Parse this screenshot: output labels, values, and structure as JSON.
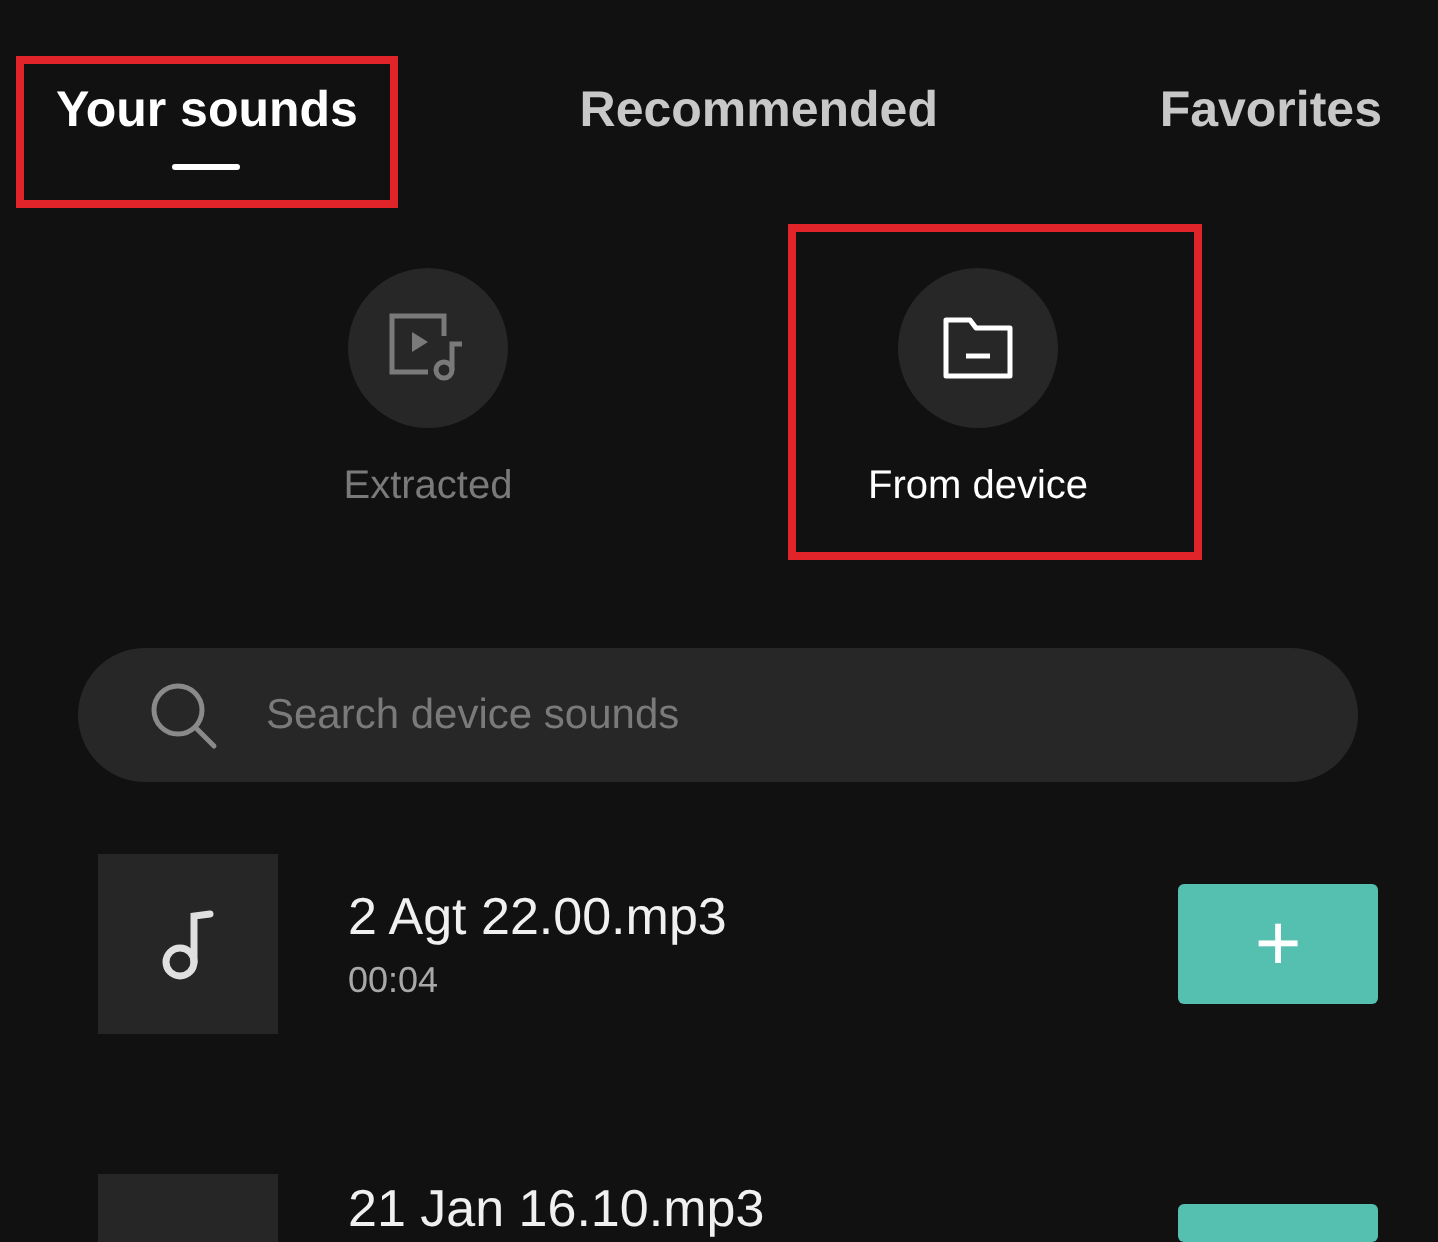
{
  "tabs": [
    {
      "label": "Your sounds",
      "selected": true,
      "highlighted": true
    },
    {
      "label": "Recommended",
      "selected": false,
      "highlighted": false
    },
    {
      "label": "Favorites",
      "selected": false,
      "highlighted": false
    }
  ],
  "sources": [
    {
      "kind": "extracted",
      "label": "Extracted",
      "selected": false,
      "highlighted": false
    },
    {
      "kind": "device",
      "label": "From device",
      "selected": true,
      "highlighted": true
    }
  ],
  "search": {
    "placeholder": "Search device sounds"
  },
  "sounds": [
    {
      "title": "2 Agt 22.00.mp3",
      "duration": "00:04",
      "add": "+"
    },
    {
      "title": "21 Jan 16.10.mp3"
    }
  ]
}
